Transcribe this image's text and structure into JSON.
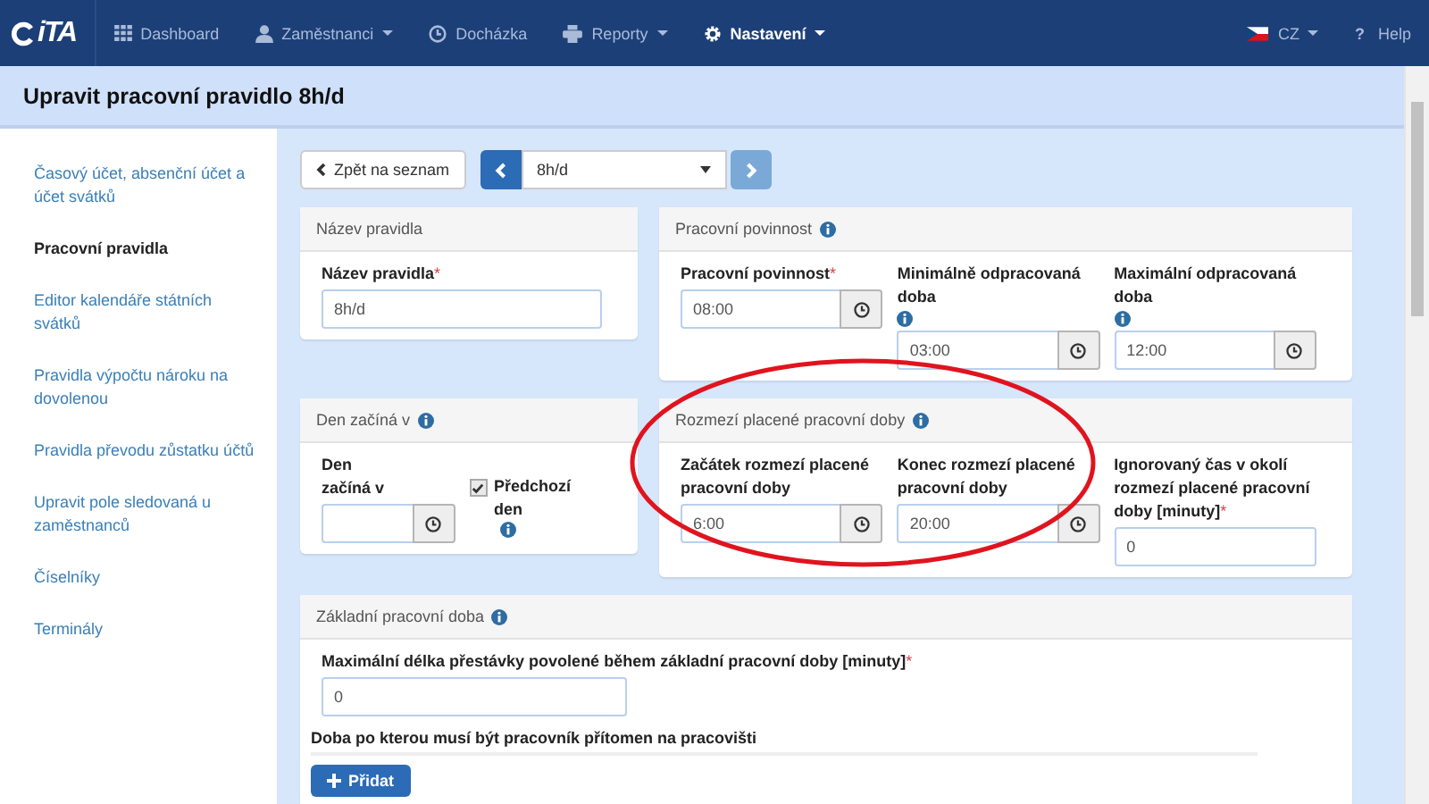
{
  "brand": "iTA",
  "nav": [
    {
      "label": "Dashboard",
      "dropdown": false,
      "selected": false
    },
    {
      "label": "Zaměstnanci",
      "dropdown": true,
      "selected": false
    },
    {
      "label": "Docházka",
      "dropdown": false,
      "selected": false
    },
    {
      "label": "Reporty",
      "dropdown": true,
      "selected": false
    },
    {
      "label": "Nastavení",
      "dropdown": true,
      "selected": true
    }
  ],
  "language": "CZ",
  "help_mark": "?",
  "help": "Help",
  "page_title": "Upravit pracovní pravidlo 8h/d",
  "required_mark": "*",
  "sidebar": [
    {
      "label": "Časový účet, absenční účet a účet svátků",
      "selected": false
    },
    {
      "label": "Pracovní pravidla",
      "selected": true
    },
    {
      "label": "Editor kalendáře státních svátků",
      "selected": false
    },
    {
      "label": "Pravidla výpočtu nároku na dovolenou",
      "selected": false
    },
    {
      "label": "Pravidla převodu zůstatku účtů",
      "selected": false
    },
    {
      "label": "Upravit pole sledovaná u zaměstnanců",
      "selected": false
    },
    {
      "label": "Číselníky",
      "selected": false
    },
    {
      "label": "Terminály",
      "selected": false
    }
  ],
  "back_button": "Zpět na seznam",
  "rule_select": "8h/d",
  "panels": [
    {
      "title": "Název pravidla",
      "info": false,
      "kind": "row",
      "fields": [
        {
          "kind": "text",
          "label": "Název pravidla",
          "required": true,
          "info": false,
          "value": "8h/d"
        }
      ]
    },
    {
      "title": "Pracovní povinnost",
      "info": true,
      "kind": "row",
      "fields": [
        {
          "kind": "time",
          "label": "Pracovní povinnost",
          "required": true,
          "info": false,
          "value": "08:00"
        },
        {
          "kind": "time",
          "label": "Minimálně odpracovaná doba",
          "required": false,
          "info": true,
          "value": "03:00"
        },
        {
          "kind": "time",
          "label": "Maximální odpracovaná doba",
          "required": false,
          "info": true,
          "value": "12:00"
        }
      ]
    },
    {
      "title": "Den začíná v",
      "info": true,
      "kind": "row",
      "fields": [
        {
          "kind": "time",
          "label": "Den začíná v",
          "required": false,
          "info": false
        },
        {
          "kind": "checkbox",
          "label": "Předchozí den",
          "checked": true,
          "info": true
        }
      ]
    },
    {
      "title": "Rozmezí placené pracovní doby",
      "info": true,
      "kind": "row",
      "fields": [
        {
          "kind": "time",
          "label": "Začátek rozmezí placené pracovní doby",
          "required": false,
          "info": false,
          "value": "6:00"
        },
        {
          "kind": "time",
          "label": "Konec rozmezí placené pracovní doby",
          "required": false,
          "info": false,
          "value": "20:00"
        },
        {
          "kind": "text",
          "label": "Ignorovaný čas v okolí rozmezí placené pracovní doby [minuty]",
          "required": true,
          "info": false,
          "value": "0"
        }
      ]
    },
    {
      "title": "Základní pracovní doba",
      "info": true,
      "kind": "stack",
      "fields": [
        {
          "kind": "text",
          "label": "Maximální délka přestávky povolené během základní pracovní doby [minuty]",
          "required": true,
          "info": false,
          "value": "0"
        },
        {
          "kind": "heading",
          "label": "Doba po kterou musí být pracovník přítomen na pracovišti"
        },
        {
          "kind": "button",
          "label": "Přidat"
        }
      ]
    }
  ]
}
